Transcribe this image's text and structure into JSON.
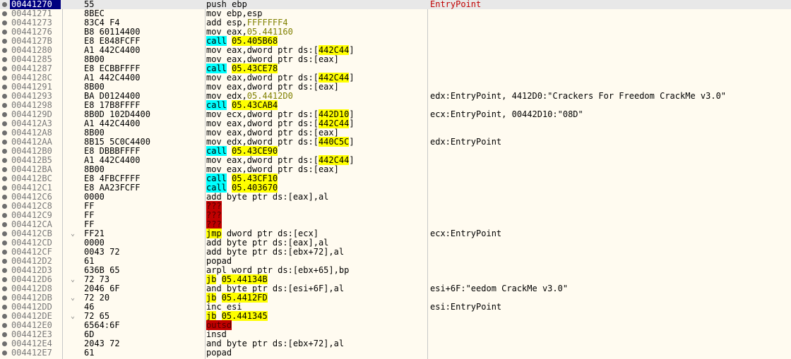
{
  "colors": {
    "background": "#fffbf0",
    "selected_address_bg": "#000080",
    "call_highlight": "#00ffff",
    "target_highlight": "#ffff00",
    "invalid_highlight": "#c00000",
    "entrypoint_comment": "#c00000"
  },
  "icons": {
    "breakpoint": "breakpoint-dot-icon",
    "jump_arrow": "chevron-down-icon"
  },
  "rows": [
    {
      "addr": "00441270",
      "bytes": "55",
      "instr": [
        {
          "t": "push ebp"
        }
      ],
      "comment": "EntryPoint",
      "ep": true,
      "selected": true
    },
    {
      "addr": "00441271",
      "bytes": "8BEC",
      "instr": [
        {
          "t": "mov ebp,esp"
        }
      ],
      "comment": ""
    },
    {
      "addr": "00441273",
      "bytes": "83C4 F4",
      "instr": [
        {
          "t": "add esp,"
        },
        {
          "t": "FFFFFFF4",
          "c": "num"
        }
      ],
      "comment": ""
    },
    {
      "addr": "00441276",
      "bytes": "B8 60114400",
      "instr": [
        {
          "t": "mov eax,"
        },
        {
          "t": "05.441160",
          "c": "num"
        }
      ],
      "comment": ""
    },
    {
      "addr": "0044127B",
      "bytes": "E8 E848FCFF",
      "instr": [
        {
          "t": "call",
          "c": "hl-cyan"
        },
        {
          "t": " "
        },
        {
          "t": "05.405B68",
          "c": "hl-yellow"
        }
      ],
      "comment": ""
    },
    {
      "addr": "00441280",
      "bytes": "A1 442C4400",
      "instr": [
        {
          "t": "mov eax,dword ptr ds:["
        },
        {
          "t": "442C44",
          "c": "hl-yellow"
        },
        {
          "t": "]"
        }
      ],
      "comment": ""
    },
    {
      "addr": "00441285",
      "bytes": "8B00",
      "instr": [
        {
          "t": "mov eax,dword ptr ds:[eax]"
        }
      ],
      "comment": ""
    },
    {
      "addr": "00441287",
      "bytes": "E8 ECBBFFFF",
      "instr": [
        {
          "t": "call",
          "c": "hl-cyan"
        },
        {
          "t": " "
        },
        {
          "t": "05.43CE78",
          "c": "hl-yellow"
        }
      ],
      "comment": ""
    },
    {
      "addr": "0044128C",
      "bytes": "A1 442C4400",
      "instr": [
        {
          "t": "mov eax,dword ptr ds:["
        },
        {
          "t": "442C44",
          "c": "hl-yellow"
        },
        {
          "t": "]"
        }
      ],
      "comment": ""
    },
    {
      "addr": "00441291",
      "bytes": "8B00",
      "instr": [
        {
          "t": "mov eax,dword ptr ds:[eax]"
        }
      ],
      "comment": ""
    },
    {
      "addr": "00441293",
      "bytes": "BA D0124400",
      "instr": [
        {
          "t": "mov edx,"
        },
        {
          "t": "05.4412D0",
          "c": "num"
        }
      ],
      "comment": "edx:EntryPoint, 4412D0:\"Crackers For Freedom CrackMe v3.0\""
    },
    {
      "addr": "00441298",
      "bytes": "E8 17B8FFFF",
      "instr": [
        {
          "t": "call",
          "c": "hl-cyan"
        },
        {
          "t": " "
        },
        {
          "t": "05.43CAB4",
          "c": "hl-yellow"
        }
      ],
      "comment": ""
    },
    {
      "addr": "0044129D",
      "bytes": "8B0D 102D4400",
      "instr": [
        {
          "t": "mov ecx,dword ptr ds:["
        },
        {
          "t": "442D10",
          "c": "hl-yellow"
        },
        {
          "t": "]"
        }
      ],
      "comment": "ecx:EntryPoint, 00442D10:\"08D\""
    },
    {
      "addr": "004412A3",
      "bytes": "A1 442C4400",
      "instr": [
        {
          "t": "mov eax,dword ptr ds:["
        },
        {
          "t": "442C44",
          "c": "hl-yellow"
        },
        {
          "t": "]"
        }
      ],
      "comment": ""
    },
    {
      "addr": "004412A8",
      "bytes": "8B00",
      "instr": [
        {
          "t": "mov eax,dword ptr ds:[eax]"
        }
      ],
      "comment": ""
    },
    {
      "addr": "004412AA",
      "bytes": "8B15 5C0C4400",
      "instr": [
        {
          "t": "mov edx,dword ptr ds:["
        },
        {
          "t": "440C5C",
          "c": "hl-yellow"
        },
        {
          "t": "]"
        }
      ],
      "comment": "edx:EntryPoint"
    },
    {
      "addr": "004412B0",
      "bytes": "E8 DBBBFFFF",
      "instr": [
        {
          "t": "call",
          "c": "hl-cyan"
        },
        {
          "t": " "
        },
        {
          "t": "05.43CE90",
          "c": "hl-yellow"
        }
      ],
      "comment": ""
    },
    {
      "addr": "004412B5",
      "bytes": "A1 442C4400",
      "instr": [
        {
          "t": "mov eax,dword ptr ds:["
        },
        {
          "t": "442C44",
          "c": "hl-yellow"
        },
        {
          "t": "]"
        }
      ],
      "comment": ""
    },
    {
      "addr": "004412BA",
      "bytes": "8B00",
      "instr": [
        {
          "t": "mov eax,dword ptr ds:[eax]"
        }
      ],
      "comment": ""
    },
    {
      "addr": "004412BC",
      "bytes": "E8 4FBCFFFF",
      "instr": [
        {
          "t": "call",
          "c": "hl-cyan"
        },
        {
          "t": " "
        },
        {
          "t": "05.43CF10",
          "c": "hl-yellow"
        }
      ],
      "comment": ""
    },
    {
      "addr": "004412C1",
      "bytes": "E8 AA23FCFF",
      "instr": [
        {
          "t": "call",
          "c": "hl-cyan"
        },
        {
          "t": " "
        },
        {
          "t": "05.403670",
          "c": "hl-yellow"
        }
      ],
      "comment": ""
    },
    {
      "addr": "004412C6",
      "bytes": "0000",
      "instr": [
        {
          "t": "add byte ptr ds:[eax],al"
        }
      ],
      "comment": ""
    },
    {
      "addr": "004412C8",
      "bytes": "FF",
      "instr": [
        {
          "t": "???",
          "c": "hl-red"
        }
      ],
      "comment": ""
    },
    {
      "addr": "004412C9",
      "bytes": "FF",
      "instr": [
        {
          "t": "???",
          "c": "hl-red"
        }
      ],
      "comment": ""
    },
    {
      "addr": "004412CA",
      "bytes": "FF",
      "instr": [
        {
          "t": "???",
          "c": "hl-red"
        }
      ],
      "comment": ""
    },
    {
      "addr": "004412CB",
      "bytes": "FF21",
      "arrow": true,
      "instr": [
        {
          "t": "jmp",
          "c": "hl-yellow"
        },
        {
          "t": " dword ptr ds:[ecx]"
        }
      ],
      "comment": "ecx:EntryPoint"
    },
    {
      "addr": "004412CD",
      "bytes": "0000",
      "instr": [
        {
          "t": "add byte ptr ds:[eax],al"
        }
      ],
      "comment": ""
    },
    {
      "addr": "004412CF",
      "bytes": "0043 72",
      "instr": [
        {
          "t": "add byte ptr ds:[ebx+72],al"
        }
      ],
      "comment": ""
    },
    {
      "addr": "004412D2",
      "bytes": "61",
      "instr": [
        {
          "t": "popad"
        }
      ],
      "comment": ""
    },
    {
      "addr": "004412D3",
      "bytes": "636B 65",
      "instr": [
        {
          "t": "arpl word ptr ds:[ebx+65],bp"
        }
      ],
      "comment": ""
    },
    {
      "addr": "004412D6",
      "bytes": "72 73",
      "arrow": true,
      "instr": [
        {
          "t": "jb",
          "c": "hl-yellow"
        },
        {
          "t": " "
        },
        {
          "t": "05.44134B",
          "c": "hl-yellow"
        }
      ],
      "comment": ""
    },
    {
      "addr": "004412D8",
      "bytes": "2046 6F",
      "instr": [
        {
          "t": "and byte ptr ds:[esi+6F],al"
        }
      ],
      "comment": "esi+6F:\"eedom CrackMe v3.0\""
    },
    {
      "addr": "004412DB",
      "bytes": "72 20",
      "arrow": true,
      "instr": [
        {
          "t": "jb",
          "c": "hl-yellow"
        },
        {
          "t": " "
        },
        {
          "t": "05.4412FD",
          "c": "hl-yellow"
        }
      ],
      "comment": ""
    },
    {
      "addr": "004412DD",
      "bytes": "46",
      "instr": [
        {
          "t": "inc esi"
        }
      ],
      "comment": "esi:EntryPoint"
    },
    {
      "addr": "004412DE",
      "bytes": "72 65",
      "arrow": true,
      "instr": [
        {
          "t": "jb",
          "c": "hl-yellow"
        },
        {
          "t": " "
        },
        {
          "t": "05.441345",
          "c": "hl-yellow"
        }
      ],
      "comment": ""
    },
    {
      "addr": "004412E0",
      "bytes": "6564:6F",
      "instr": [
        {
          "t": "outsd",
          "c": "hl-red"
        }
      ],
      "comment": ""
    },
    {
      "addr": "004412E3",
      "bytes": "6D",
      "instr": [
        {
          "t": "insd"
        }
      ],
      "comment": ""
    },
    {
      "addr": "004412E4",
      "bytes": "2043 72",
      "instr": [
        {
          "t": "and byte ptr ds:[ebx+72],al"
        }
      ],
      "comment": ""
    },
    {
      "addr": "004412E7",
      "bytes": "61",
      "instr": [
        {
          "t": "popad"
        }
      ],
      "comment": ""
    }
  ]
}
